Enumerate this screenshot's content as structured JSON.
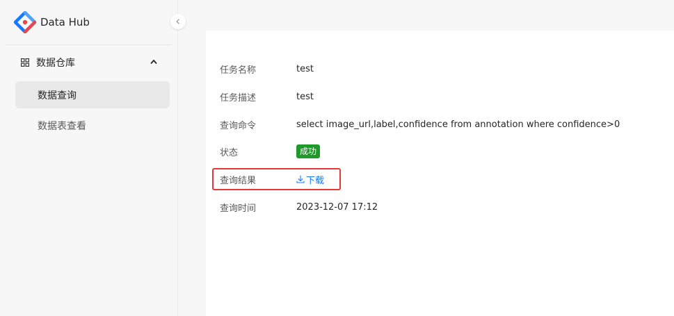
{
  "app": {
    "name": "Data Hub"
  },
  "sidebar": {
    "group_label": "数据仓库",
    "items": [
      {
        "label": "数据查询",
        "active": true
      },
      {
        "label": "数据表查看",
        "active": false
      }
    ]
  },
  "detail": {
    "task_name_label": "任务名称",
    "task_name_value": "test",
    "task_desc_label": "任务描述",
    "task_desc_value": "test",
    "query_cmd_label": "查询命令",
    "query_cmd_value": "select image_url,label,confidence from annotation where confidence>0",
    "status_label": "状态",
    "status_value": "成功",
    "result_label": "查询结果",
    "result_link": "下载",
    "time_label": "查询时间",
    "time_value": "2023-12-07 17:12"
  },
  "colors": {
    "brand_blue": "#1677ff",
    "brand_red": "#e5484d",
    "status_success": "#1f9a2a",
    "highlight": "#e53935"
  }
}
